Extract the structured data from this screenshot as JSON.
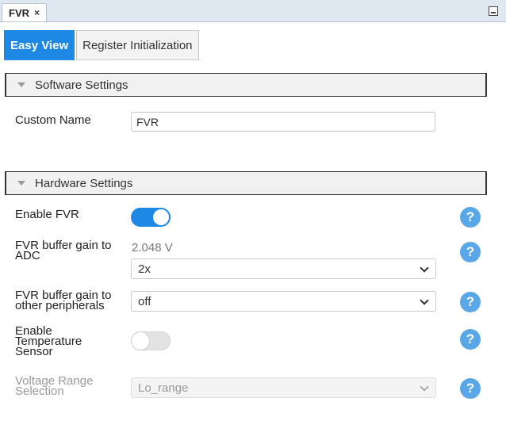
{
  "window": {
    "tab_title": "FVR",
    "close_glyph": "×"
  },
  "tabs": [
    {
      "label": "Easy View",
      "active": true
    },
    {
      "label": "Register Initialization",
      "active": false
    }
  ],
  "software_settings": {
    "header": "Software Settings",
    "custom_name": {
      "label": "Custom Name",
      "value": "FVR"
    }
  },
  "hardware_settings": {
    "header": "Hardware Settings",
    "enable_fvr": {
      "label": "Enable FVR",
      "on": true
    },
    "fvr_adc": {
      "label_line1": "FVR buffer gain to",
      "label_line2": "ADC",
      "voltage": "2.048 V",
      "selected": "2x"
    },
    "fvr_other": {
      "label_line1": "FVR buffer gain to",
      "label_line2": "other peripherals",
      "selected": "off"
    },
    "temp_sensor": {
      "label_line1": "Enable",
      "label_line2": "Temperature",
      "label_line3": "Sensor",
      "on": false
    },
    "voltage_range": {
      "label_line1": "Voltage Range",
      "label_line2": "Selection",
      "selected": "Lo_range",
      "disabled": true
    }
  },
  "help_glyph": "?",
  "colors": {
    "accent": "#1e88e5",
    "help": "#5aa7e8",
    "titlebar": "#dfe7f1"
  }
}
